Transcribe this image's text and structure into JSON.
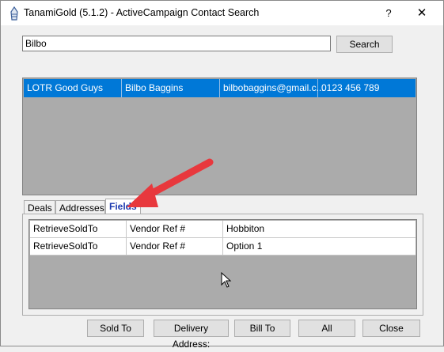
{
  "window": {
    "title": "TanamiGold (5.1.2) - ActiveCampaign Contact Search",
    "help_label": "?",
    "close_label": "✕"
  },
  "search": {
    "value": "Bilbo",
    "button_label": "Search"
  },
  "results": [
    {
      "group": "LOTR Good Guys",
      "name": "Bilbo Baggins",
      "email": "bilbobaggins@gmail.c...",
      "phone": "0123 456 789"
    }
  ],
  "tabs": [
    {
      "label": "Deals"
    },
    {
      "label": "Addresses"
    },
    {
      "label": "Fields"
    }
  ],
  "fields_rows": [
    {
      "action": "RetrieveSoldTo",
      "field": "Vendor Ref #",
      "value": "Hobbiton"
    },
    {
      "action": "RetrieveSoldTo",
      "field": "Vendor Ref #",
      "value": "Option 1"
    }
  ],
  "buttons": {
    "sold_to": "Sold To",
    "delivery_address": "Delivery Address:",
    "bill_to": "Bill To",
    "all": "All",
    "close": "Close"
  },
  "colors": {
    "selection": "#0078d7",
    "arrow": "#e8383d",
    "grid_background": "#ababab"
  },
  "icons": [
    "app-icon",
    "annotation-arrow",
    "mouse-cursor"
  ]
}
